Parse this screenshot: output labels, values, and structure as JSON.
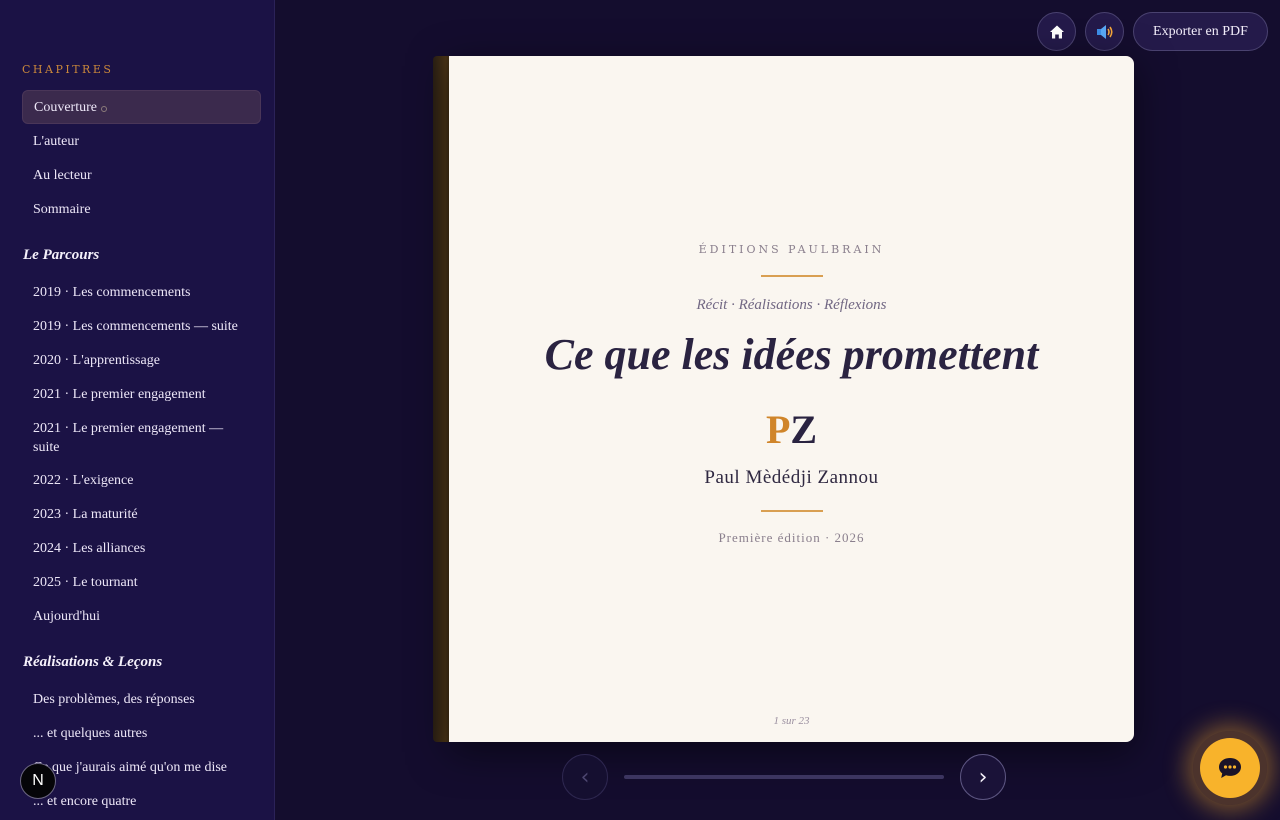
{
  "sidebar": {
    "heading": "CHAPITRES",
    "intro_items": [
      {
        "label": "Couverture",
        "active": true
      },
      {
        "label": "L'auteur"
      },
      {
        "label": "Au lecteur"
      },
      {
        "label": "Sommaire"
      }
    ],
    "sections": [
      {
        "title": "Le Parcours",
        "items": [
          "2019 · Les commencements",
          "2019 · Les commencements — suite",
          "2020 · L'apprentissage",
          "2021 · Le premier engagement",
          "2021 · Le premier engagement — suite",
          "2022 · L'exigence",
          "2023 · La maturité",
          "2024 · Les alliances",
          "2025 · Le tournant",
          "Aujourd'hui"
        ]
      },
      {
        "title": "Réalisations & Leçons",
        "items": [
          "Des problèmes, des réponses",
          "... et quelques autres",
          "Ce que j'aurais aimé qu'on me dise",
          "... et encore quatre"
        ]
      }
    ],
    "badge": "N"
  },
  "toolbar": {
    "home_icon": "home-icon",
    "sound_icon": "speaker-icon",
    "export_label": "Exporter en PDF"
  },
  "book": {
    "publisher": "ÉDITIONS PAULBRAIN",
    "subtitle": "Récit · Réalisations · Réflexions",
    "title": "Ce que les idées promettent",
    "monogram_first": "P",
    "monogram_second": "Z",
    "author": "Paul Mèdédji Zannou",
    "edition": "Première édition · 2026",
    "page_indicator": "1 sur 23"
  },
  "navigation": {
    "prev_label": "‹",
    "next_label": "›",
    "progress": 0
  },
  "chat": {
    "icon": "chat-icon"
  },
  "colors": {
    "background": "#140d2e",
    "sidebar": "#1b1245",
    "accent": "#d99f52",
    "chat": "#f8b32b",
    "page": "#faf6f0"
  }
}
